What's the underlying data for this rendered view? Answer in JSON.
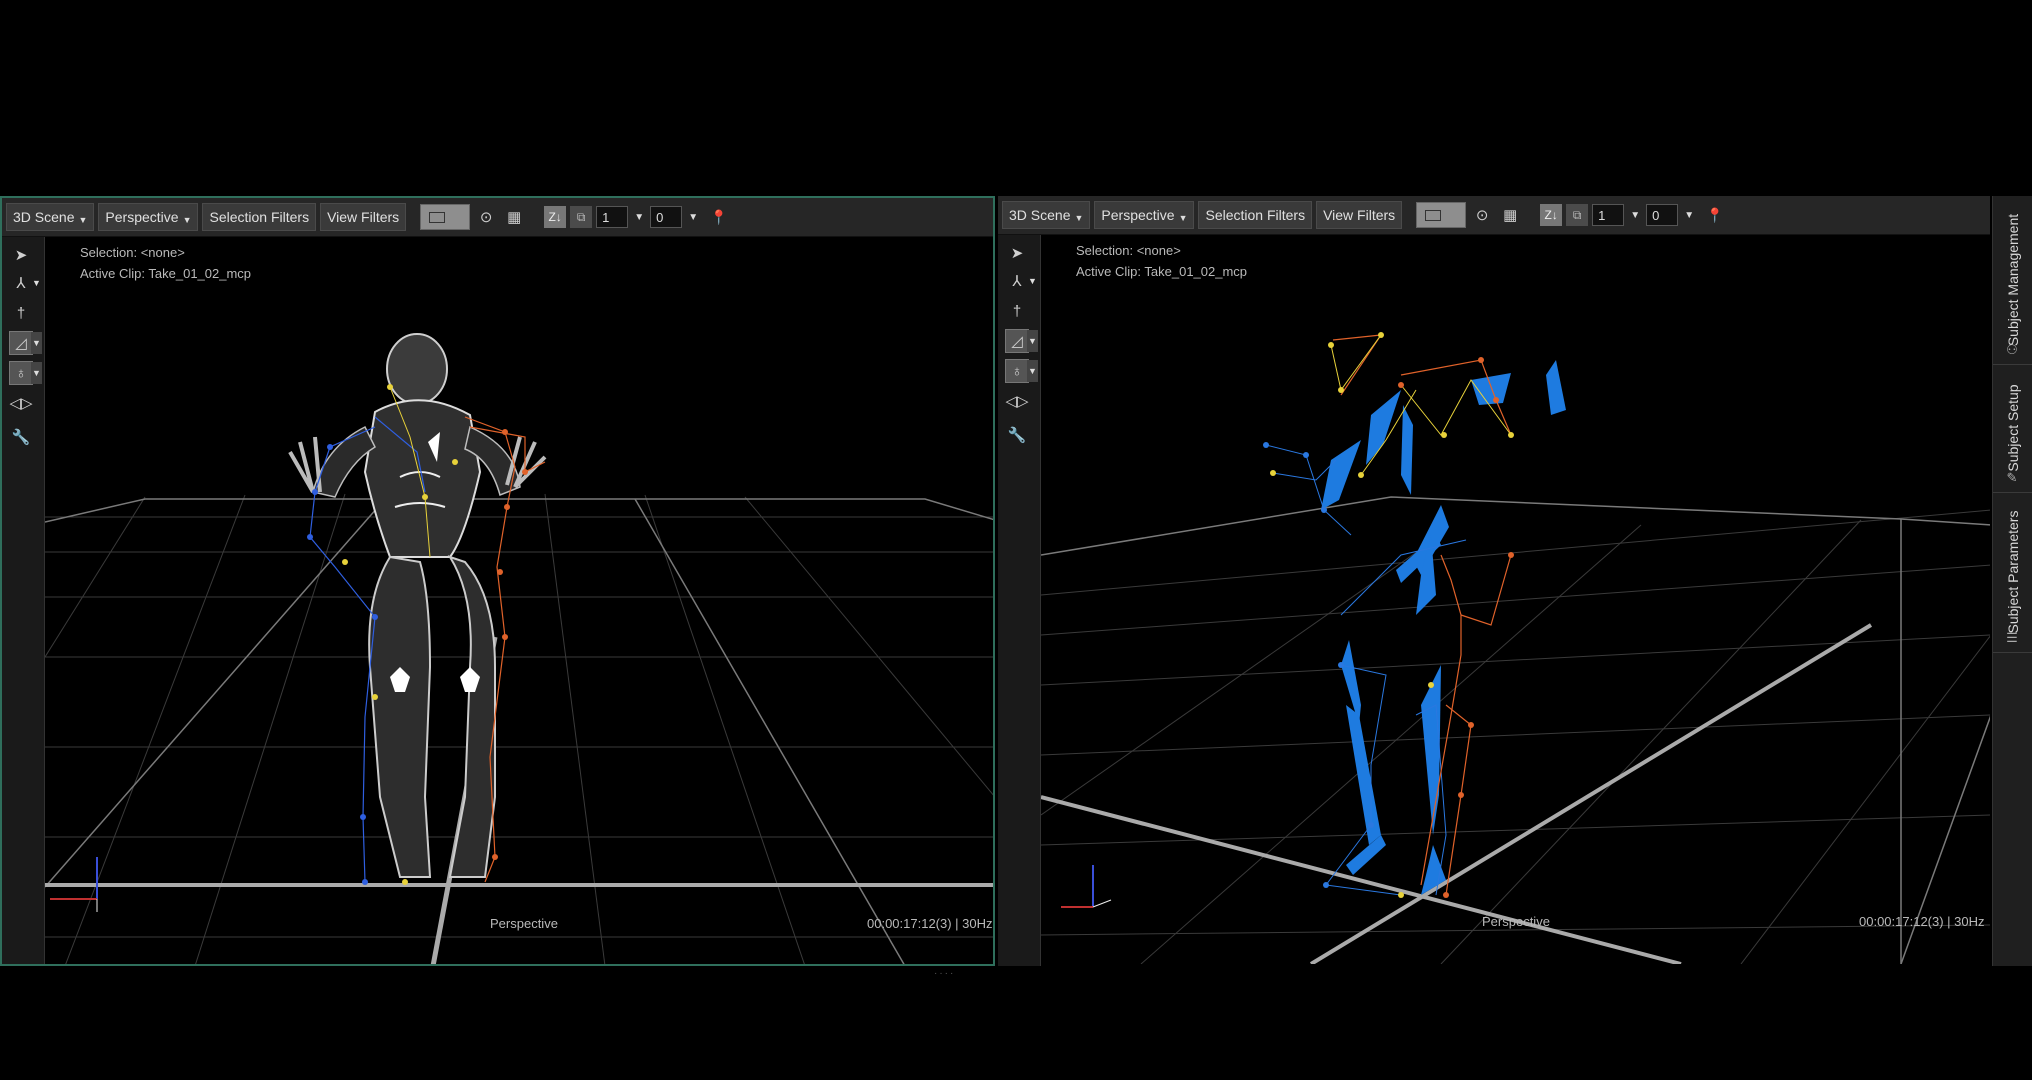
{
  "left_viewport": {
    "toolbar": {
      "scene": "3D Scene",
      "view": "Perspective",
      "selection_filters": "Selection Filters",
      "view_filters": "View Filters",
      "field1": "1",
      "field2": "0"
    },
    "selection": "Selection: <none>",
    "active_clip": "Active Clip: Take_01_02_mcp",
    "camera_label": "Perspective",
    "timecode": "00:00:17:12(3) | 30Hz"
  },
  "right_viewport": {
    "toolbar": {
      "scene": "3D Scene",
      "view": "Perspective",
      "selection_filters": "Selection Filters",
      "view_filters": "View Filters",
      "field1": "1",
      "field2": "0"
    },
    "selection": "Selection: <none>",
    "active_clip": "Active Clip: Take_01_02_mcp",
    "camera_label": "Perspective",
    "timecode": "00:00:17:12(3) | 30Hz"
  },
  "side_tabs": {
    "subject_management": "Subject Management",
    "subject_setup": "Subject Setup",
    "subject_parameters": "Subject Parameters"
  },
  "colors": {
    "pane_border_active": "#2f6f5c",
    "segment_blue": "#1e7be0",
    "marker_yellow": "#e8d23a",
    "marker_orange": "#e0622a"
  }
}
